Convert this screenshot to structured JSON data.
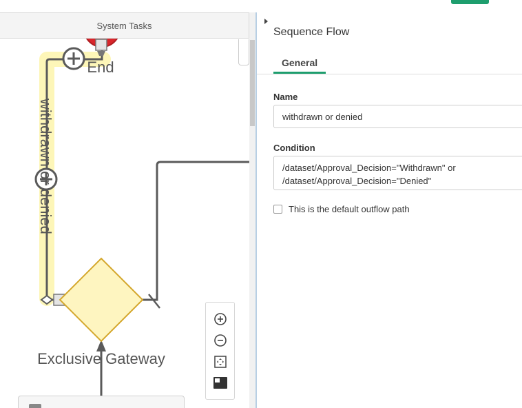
{
  "canvas": {
    "lane_title": "System Tasks",
    "end_event_label": "End",
    "flow_label": "withdrawn or denied",
    "gateway_label": "Exclusive Gateway",
    "zoom_controls": [
      {
        "name": "zoom-in-icon"
      },
      {
        "name": "zoom-out-icon"
      },
      {
        "name": "fit-to-screen-icon"
      },
      {
        "name": "minimap-toggle-icon"
      }
    ]
  },
  "colors": {
    "accent": "#1e9e6e",
    "selection_highlight": "#fdf6b8",
    "gateway_fill": "#fef5c0",
    "gateway_stroke": "#d4a72c",
    "end_event_fill": "#d9262b",
    "connector": "#5a5a5a"
  },
  "properties": {
    "title": "Sequence Flow",
    "tabs": [
      {
        "label": "General",
        "active": true
      }
    ],
    "name_label": "Name",
    "name_value": "withdrawn or denied",
    "condition_label": "Condition",
    "condition_value": "/dataset/Approval_Decision=\"Withdrawn\" or\n/dataset/Approval_Decision=\"Denied\"",
    "default_outflow_label": "This is the default outflow path",
    "default_outflow_checked": false
  }
}
